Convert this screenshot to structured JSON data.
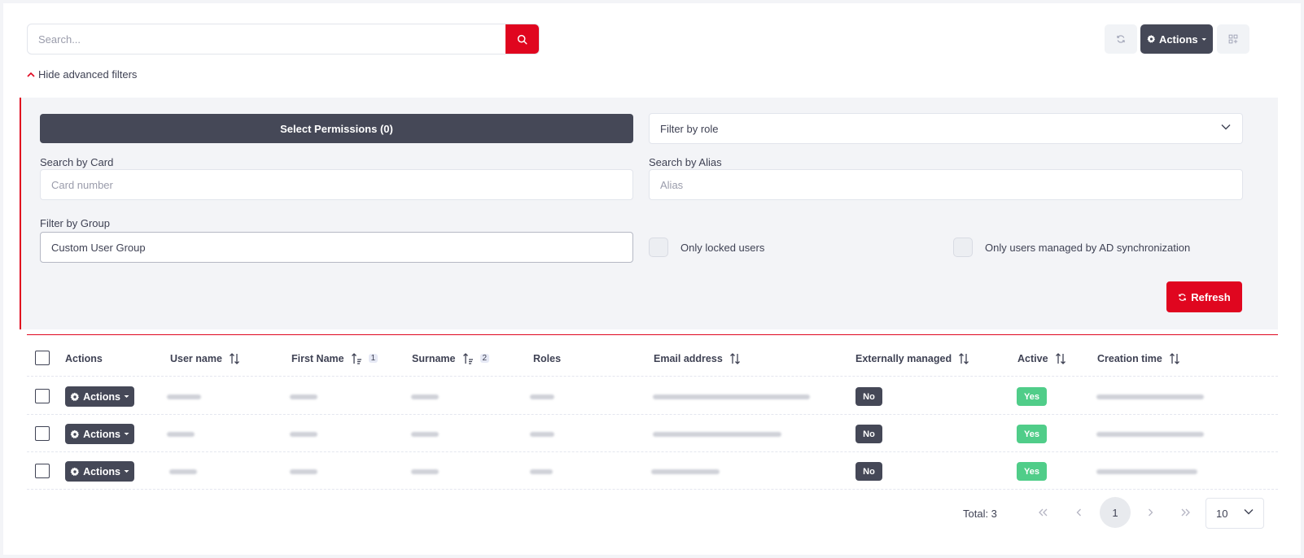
{
  "search": {
    "placeholder": "Search..."
  },
  "toolbar": {
    "actions_label": "Actions"
  },
  "advanced_filters": {
    "toggle_label": "Hide advanced filters"
  },
  "filters": {
    "permissions_button": "Select Permissions (0)",
    "role_select": "Filter by role",
    "card_label": "Search by Card",
    "card_placeholder": "Card number",
    "alias_label": "Search by Alias",
    "alias_placeholder": "Alias",
    "group_label": "Filter by Group",
    "group_value": "Custom User Group",
    "only_locked_label": "Only locked users",
    "only_ad_label": "Only users managed by AD synchronization",
    "refresh_label": "Refresh"
  },
  "table": {
    "columns": {
      "actions": "Actions",
      "user_name": "User name",
      "first_name": "First Name",
      "first_name_sort_order": "1",
      "surname": "Surname",
      "surname_sort_order": "2",
      "roles": "Roles",
      "email": "Email address",
      "externally_managed": "Externally managed",
      "active": "Active",
      "creation_time": "Creation time"
    },
    "rows": [
      {
        "actions_label": "Actions",
        "externally_managed": "No",
        "active": "Yes"
      },
      {
        "actions_label": "Actions",
        "externally_managed": "No",
        "active": "Yes"
      },
      {
        "actions_label": "Actions",
        "externally_managed": "No",
        "active": "Yes"
      }
    ]
  },
  "pagination": {
    "total": "Total: 3",
    "current_page": "1",
    "page_size": "10"
  },
  "colors": {
    "accent": "#e0061f",
    "dark": "#454857",
    "success": "#50cd89"
  }
}
